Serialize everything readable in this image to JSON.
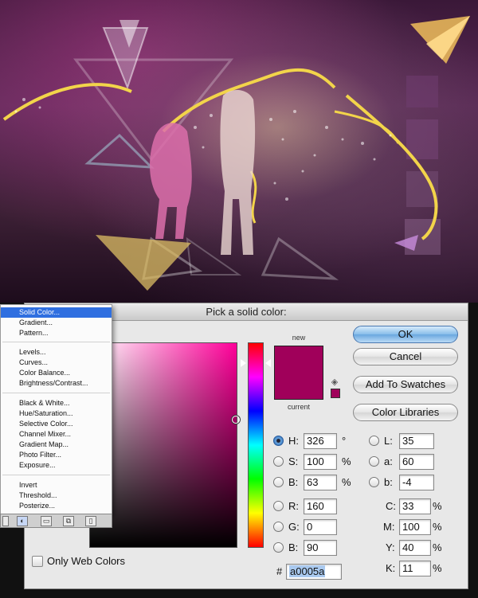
{
  "dialog": {
    "title": "Pick a solid color:",
    "new_label": "new",
    "current_label": "current",
    "new_color": "#a0005a",
    "current_color": "#a0005a",
    "hue_field_base": "#ff0099"
  },
  "buttons": {
    "ok": "OK",
    "cancel": "Cancel",
    "add_to_swatches": "Add To Swatches",
    "color_libraries": "Color Libraries"
  },
  "fields": {
    "H": {
      "label": "H:",
      "value": "326",
      "unit": "°"
    },
    "S": {
      "label": "S:",
      "value": "100",
      "unit": "%"
    },
    "Bv": {
      "label": "B:",
      "value": "63",
      "unit": "%"
    },
    "R": {
      "label": "R:",
      "value": "160"
    },
    "G": {
      "label": "G:",
      "value": "0"
    },
    "Bl": {
      "label": "B:",
      "value": "90"
    },
    "L": {
      "label": "L:",
      "value": "35"
    },
    "a": {
      "label": "a:",
      "value": "60"
    },
    "b": {
      "label": "b:",
      "value": "-4"
    },
    "C": {
      "label": "C:",
      "value": "33",
      "unit": "%"
    },
    "M": {
      "label": "M:",
      "value": "100",
      "unit": "%"
    },
    "Y": {
      "label": "Y:",
      "value": "40",
      "unit": "%"
    },
    "K": {
      "label": "K:",
      "value": "11",
      "unit": "%"
    }
  },
  "hex": {
    "label": "#",
    "value": "a0005a"
  },
  "only_web_colors": "Only Web Colors",
  "menu": {
    "items": [
      "Solid Color...",
      "Gradient...",
      "Pattern...",
      "Levels...",
      "Curves...",
      "Color Balance...",
      "Brightness/Contrast...",
      "Black & White...",
      "Hue/Saturation...",
      "Selective Color...",
      "Channel Mixer...",
      "Gradient Map...",
      "Photo Filter...",
      "Exposure...",
      "Invert",
      "Threshold...",
      "Posterize..."
    ],
    "selected": "Solid Color..."
  }
}
